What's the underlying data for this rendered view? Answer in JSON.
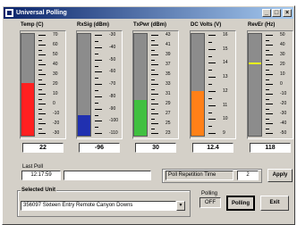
{
  "window": {
    "title": "Universal Polling"
  },
  "colors": {
    "temp": "#ff2020",
    "rx": "#2030b0",
    "tx": "#40c040",
    "dc": "#ff8018",
    "marker": "#e8ff1e"
  },
  "gauges": [
    {
      "label": "Temp (C)",
      "ticks": [
        "70",
        "60",
        "50",
        "40",
        "30",
        "20",
        "10",
        "0",
        "-10",
        "-20",
        "-30"
      ],
      "readout": "22",
      "fill_fraction": 0.52,
      "fill_color": "#ff2020"
    },
    {
      "label": "RxSig (dBm)",
      "ticks": [
        "-30",
        "-40",
        "-50",
        "-60",
        "-70",
        "-80",
        "-90",
        "-100",
        "-110"
      ],
      "readout": "-96",
      "fill_fraction": 0.2,
      "fill_color": "#2030b0"
    },
    {
      "label": "TxPwr (dBm)",
      "ticks": [
        "43",
        "41",
        "39",
        "37",
        "35",
        "33",
        "31",
        "29",
        "27",
        "25",
        "23"
      ],
      "readout": "30",
      "fill_fraction": 0.35,
      "fill_color": "#40c040"
    },
    {
      "label": "DC Volts (V)",
      "ticks": [
        "16",
        "15",
        "14",
        "13",
        "12",
        "11",
        "10",
        "9"
      ],
      "readout": "12.4",
      "fill_fraction": 0.44,
      "fill_color": "#ff8018"
    },
    {
      "label": "RevEr (Hz)",
      "ticks": [
        "50",
        "40",
        "30",
        "20",
        "10",
        "0",
        "-10",
        "-20",
        "-30",
        "-40",
        "-50"
      ],
      "readout": "118",
      "marker_fraction": 0.7
    }
  ],
  "last_poll": {
    "label": "Last Poll",
    "value": "12:17:59"
  },
  "poll_rep": {
    "label": "Poll Repetition Time",
    "value": "2",
    "apply_label": "Apply"
  },
  "selected_unit": {
    "label": "Selected Unit",
    "value": "356097 Sixteen Entry Remote Canyon Downs"
  },
  "polling": {
    "label": "Polling",
    "status": "OFF",
    "polling_button": "Polling",
    "exit_button": "Exit"
  }
}
